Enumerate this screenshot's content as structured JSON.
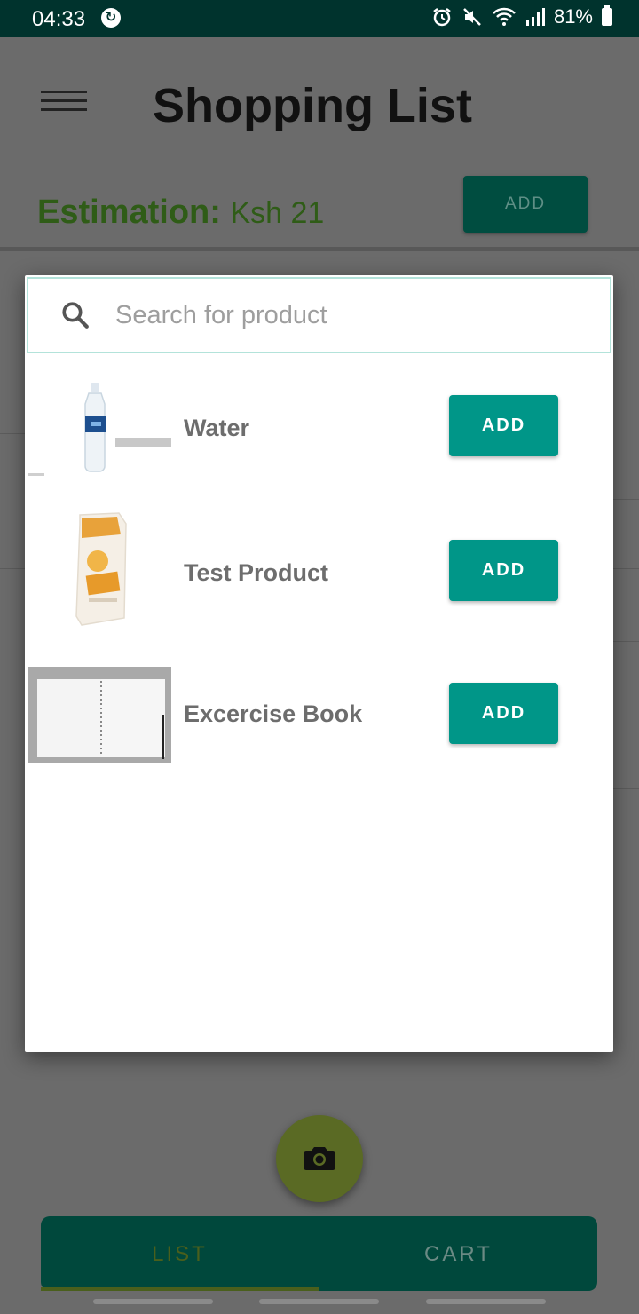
{
  "status_bar": {
    "time": "04:33",
    "sync_glyph": "↻",
    "battery": "81%",
    "icons": [
      "alarm-icon",
      "mute-icon",
      "wifi-icon",
      "signal-icon",
      "battery-icon"
    ]
  },
  "header": {
    "title": "Shopping List"
  },
  "estimation": {
    "label": "Estimation:",
    "value": "Ksh 21",
    "add_label": "ADD"
  },
  "dialog": {
    "search": {
      "placeholder": "Search for product",
      "value": ""
    },
    "products": [
      {
        "name": "Water",
        "image": "water-bottle-image",
        "add_label": "ADD"
      },
      {
        "name": "Test Product",
        "image": "oats-bag-image",
        "add_label": "ADD"
      },
      {
        "name": "Excercise Book",
        "image": "notebook-image",
        "add_label": "ADD"
      }
    ]
  },
  "fab": {
    "icon": "camera-icon"
  },
  "bottom_nav": {
    "tabs": [
      {
        "label": "LIST",
        "active": true
      },
      {
        "label": "CART",
        "active": false
      }
    ]
  },
  "colors": {
    "status_bar": "#00332d",
    "scrim": "#6b6b6b",
    "accent": "#009688",
    "estimation_text": "#2f5c17",
    "nav": "#00483c"
  }
}
